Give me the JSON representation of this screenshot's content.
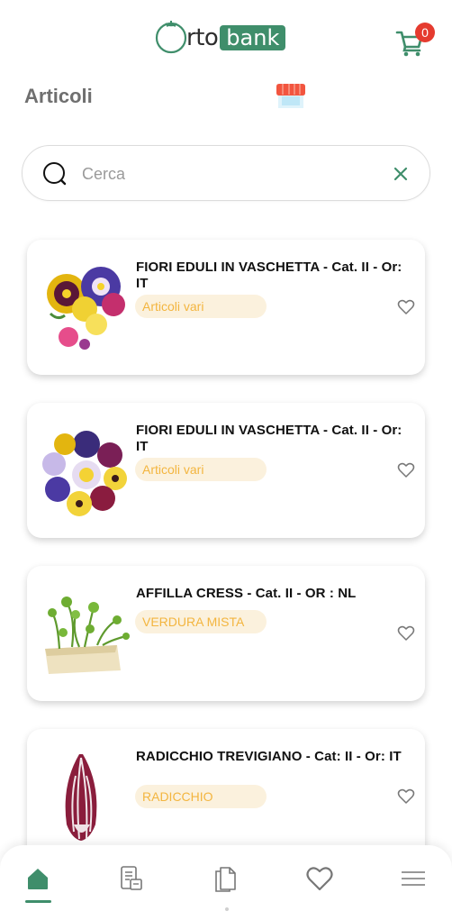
{
  "header": {
    "logo_rto": "rto",
    "logo_bank": "bank",
    "cart_count": "0"
  },
  "page": {
    "title": "Articoli"
  },
  "search": {
    "placeholder": "Cerca",
    "value": ""
  },
  "products": [
    {
      "title": "FIORI EDULI IN VASCHETTA - Cat. II - Or: IT",
      "tag": "Articoli vari",
      "image": "edible-flowers-pansies",
      "favorite": false
    },
    {
      "title": "FIORI EDULI IN VASCHETTA - Cat. II - Or: IT",
      "tag": "Articoli vari",
      "image": "edible-flowers-ring",
      "favorite": false
    },
    {
      "title": "AFFILLA CRESS - Cat. II - OR : NL",
      "tag": "VERDURA MISTA",
      "image": "affilla-cress",
      "favorite": false
    },
    {
      "title": "RADICCHIO TREVIGIANO - Cat: II - Or: IT",
      "tag": "RADICCHIO",
      "image": "radicchio",
      "favorite": false
    }
  ],
  "bottom_nav": {
    "items": [
      {
        "icon": "home-icon",
        "active": true
      },
      {
        "icon": "orders-icon",
        "active": false
      },
      {
        "icon": "documents-icon",
        "active": false
      },
      {
        "icon": "heart-icon",
        "active": false
      },
      {
        "icon": "menu-icon",
        "active": false
      }
    ]
  },
  "colors": {
    "brand_green": "#3f8e6b",
    "tag_background": "#fbf1dd",
    "tag_text": "#f3b53f",
    "badge_red": "#e53b2f",
    "title_gray": "#6f6f6f"
  }
}
